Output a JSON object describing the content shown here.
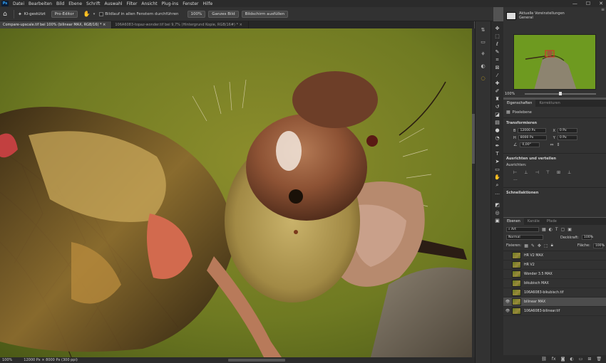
{
  "app": {
    "logo": "Ps"
  },
  "menu": [
    "Datei",
    "Bearbeiten",
    "Bild",
    "Ebene",
    "Schrift",
    "Auswahl",
    "Filter",
    "Ansicht",
    "Plug-ins",
    "Fenster",
    "Hilfe"
  ],
  "window_controls": {
    "minimize": "—",
    "maximize": "☐",
    "close": "✕"
  },
  "options": {
    "ai_label": "KI-gestützt",
    "pro_label": "Pro-Editor",
    "scroll_all_label": "Bildlauf in allen Fenstern durchführen",
    "zoom_value": "100%",
    "fit_label": "Ganzes Bild",
    "fill_label": "Bildschirm ausfüllen"
  },
  "tabs": [
    {
      "label": "Compare-upscale.tif bei 100% (bilinear MAX, RGB/16) *"
    },
    {
      "label": "106A6083-topaz-wonder.tif bei 9,7% (Hintergrund Kopie, RGB/16#) *"
    }
  ],
  "status": {
    "zoom": "100%",
    "size": "12000 Px × 8000 Px (300 ppi)"
  },
  "history": {
    "title": "Aktuelle Voreinstellungen",
    "subtitle": "General"
  },
  "navigator": {
    "zoom": "100%"
  },
  "properties": {
    "tabs": [
      "Eigenschaften",
      "Korrekturen"
    ],
    "layer_type": "Pixelebene",
    "transform_title": "Transformieren",
    "width_label": "B",
    "width_value": "12000 Px",
    "x_label": "X",
    "x_value": "0 Px",
    "height_label": "H",
    "height_value": "8000 Px",
    "y_label": "Y",
    "y_value": "0 Px",
    "angle_value": "0,00°",
    "align_title": "Ausrichten und verteilen",
    "align_sub": "Ausrichten:",
    "quick_title": "Schnellaktionen"
  },
  "layers": {
    "tabs": [
      "Ebenen",
      "Kanäle",
      "Pfade"
    ],
    "filter": "Art",
    "blend": "Normal",
    "opacity_label": "Deckkraft:",
    "opacity_value": "100%",
    "lock_label": "Fixieren:",
    "fill_label": "Fläche:",
    "fill_value": "100%",
    "items": [
      {
        "name": "HR V2 MAX",
        "visible": false,
        "selected": false
      },
      {
        "name": "HR V2",
        "visible": false,
        "selected": false
      },
      {
        "name": "Wonder 3.5 MAX",
        "visible": false,
        "selected": false
      },
      {
        "name": "bikubisch MAX",
        "visible": false,
        "selected": false
      },
      {
        "name": "106A6083-bikubisch.tif",
        "visible": false,
        "selected": false
      },
      {
        "name": "bilinear MAX",
        "visible": true,
        "selected": true
      },
      {
        "name": "106A6083-bilinear.tif",
        "visible": true,
        "selected": false
      }
    ]
  },
  "colors": {
    "accent": "#31a8ff",
    "panel": "#323232",
    "canvas_green": "#6b7a24"
  }
}
